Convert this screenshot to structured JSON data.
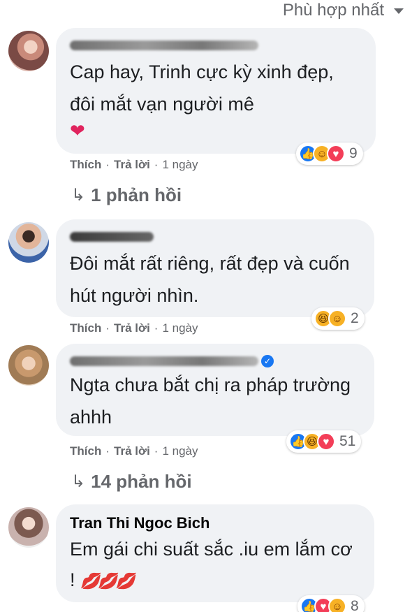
{
  "sort": {
    "label": "Phù hợp nhất"
  },
  "actions": {
    "like": "Thích",
    "reply": "Trả lời"
  },
  "comments": [
    {
      "author": "",
      "text": "Cap hay, Trinh cực kỳ xinh đẹp, đôi mắt vạn người mê",
      "emoji": "❤",
      "time": "1 ngày",
      "reaction_icons": [
        "like-icon",
        "care-icon",
        "love-icon"
      ],
      "reaction_count": "9",
      "replies_label": "1 phản hồi"
    },
    {
      "author": "",
      "text": "Đôi mắt rất riêng, rất đẹp và cuốn hút người nhìn.",
      "time": "1 ngày",
      "reaction_icons": [
        "haha-icon",
        "care-icon"
      ],
      "reaction_count": "2"
    },
    {
      "author": "",
      "text": "Ngta chưa bắt chị ra pháp trường ahhh",
      "time": "1 ngày",
      "reaction_icons": [
        "like-icon",
        "haha-icon",
        "love-icon"
      ],
      "reaction_count": "51",
      "replies_label": "14 phản hồi"
    },
    {
      "author": "Tran Thi Ngoc Bich",
      "text": "Em gái chi suất sắc .iu em lắm cơ !",
      "emoji": "💋💋💋",
      "reaction_icons": [
        "like-icon",
        "love-icon",
        "care-icon"
      ],
      "reaction_count": "8"
    }
  ],
  "colors": {
    "bubble": "#f0f2f5",
    "meta": "#65676b",
    "like": "#1877f2",
    "love": "#f33e58",
    "care": "#f7b125"
  }
}
